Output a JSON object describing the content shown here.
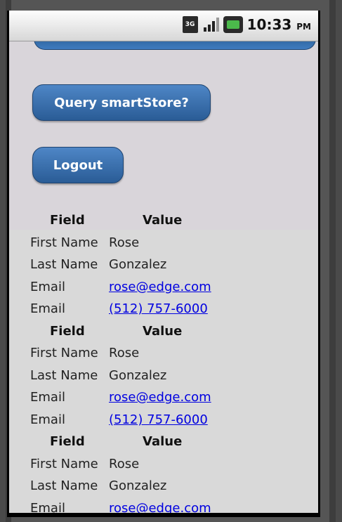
{
  "status_bar": {
    "network_type": "3G",
    "time": "10:33",
    "ampm": "PM"
  },
  "buttons": {
    "query_label": "Query smartStore?",
    "logout_label": "Logout"
  },
  "table": {
    "header": {
      "field": "Field",
      "value": "Value"
    },
    "records": [
      {
        "rows": [
          {
            "field": "First Name",
            "value": "Rose",
            "link": false
          },
          {
            "field": "Last Name",
            "value": "Gonzalez",
            "link": false
          },
          {
            "field": "Email",
            "value": "rose@edge.com",
            "link": true
          },
          {
            "field": "Email",
            "value": "(512) 757-6000",
            "link": true
          }
        ]
      },
      {
        "rows": [
          {
            "field": "First Name",
            "value": "Rose",
            "link": false
          },
          {
            "field": "Last Name",
            "value": "Gonzalez",
            "link": false
          },
          {
            "field": "Email",
            "value": "rose@edge.com",
            "link": true
          },
          {
            "field": "Email",
            "value": "(512) 757-6000",
            "link": true
          }
        ]
      },
      {
        "rows": [
          {
            "field": "First Name",
            "value": "Rose",
            "link": false
          },
          {
            "field": "Last Name",
            "value": "Gonzalez",
            "link": false
          },
          {
            "field": "Email",
            "value": "rose@edge.com",
            "link": true
          }
        ]
      }
    ]
  },
  "colors": {
    "button_blue": "#3a6fae",
    "link_blue": "#0000e0",
    "background": "#d9d5da"
  }
}
